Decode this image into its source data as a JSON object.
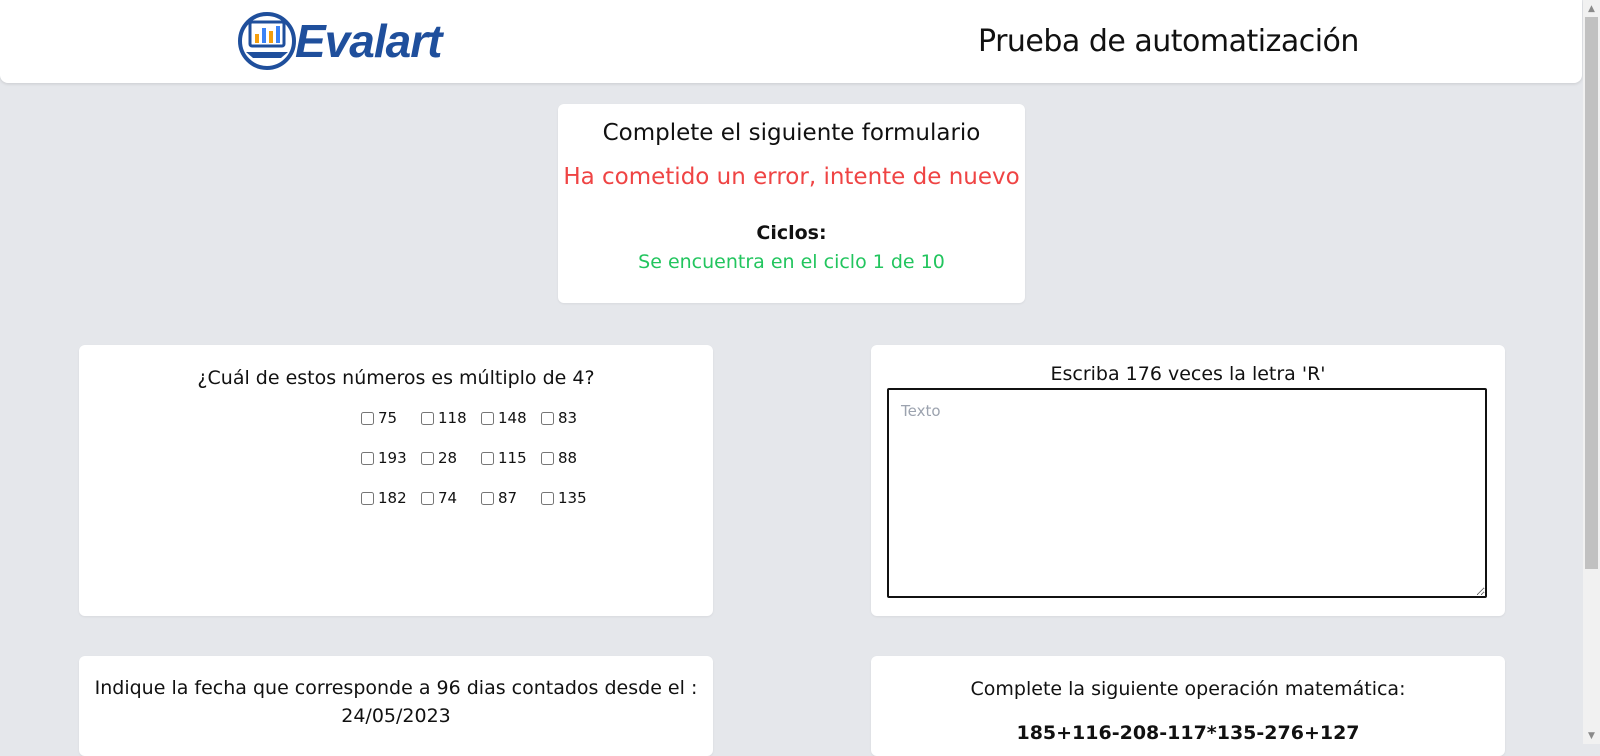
{
  "header": {
    "logo_text": "Evalart",
    "title": "Prueba de automatización"
  },
  "status": {
    "title": "Complete el siguiente formulario",
    "error": "Ha cometido un error, intente de nuevo",
    "cycles_label": "Ciclos:",
    "cycles_value": "Se encuentra en el ciclo 1 de 10"
  },
  "multiple_question": {
    "title": "¿Cuál de estos números es múltiplo de 4?",
    "rows": [
      [
        "75",
        "118",
        "148",
        "83"
      ],
      [
        "193",
        "28",
        "115",
        "88"
      ],
      [
        "182",
        "74",
        "87",
        "135"
      ]
    ]
  },
  "text_question": {
    "title": "Escriba 176 veces la letra 'R'",
    "placeholder": "Texto",
    "value": ""
  },
  "date_question": {
    "line1": "Indique la fecha que corresponde a 96 dias contados desde el :",
    "line2": "24/05/2023"
  },
  "math_question": {
    "title": "Complete la siguiente operación matemática:",
    "operation": "185+116-208-117*135-276+127"
  },
  "colors": {
    "background": "#e5e7eb",
    "error": "#ef4444",
    "success": "#22c55e",
    "brand": "#1f4f9c"
  }
}
